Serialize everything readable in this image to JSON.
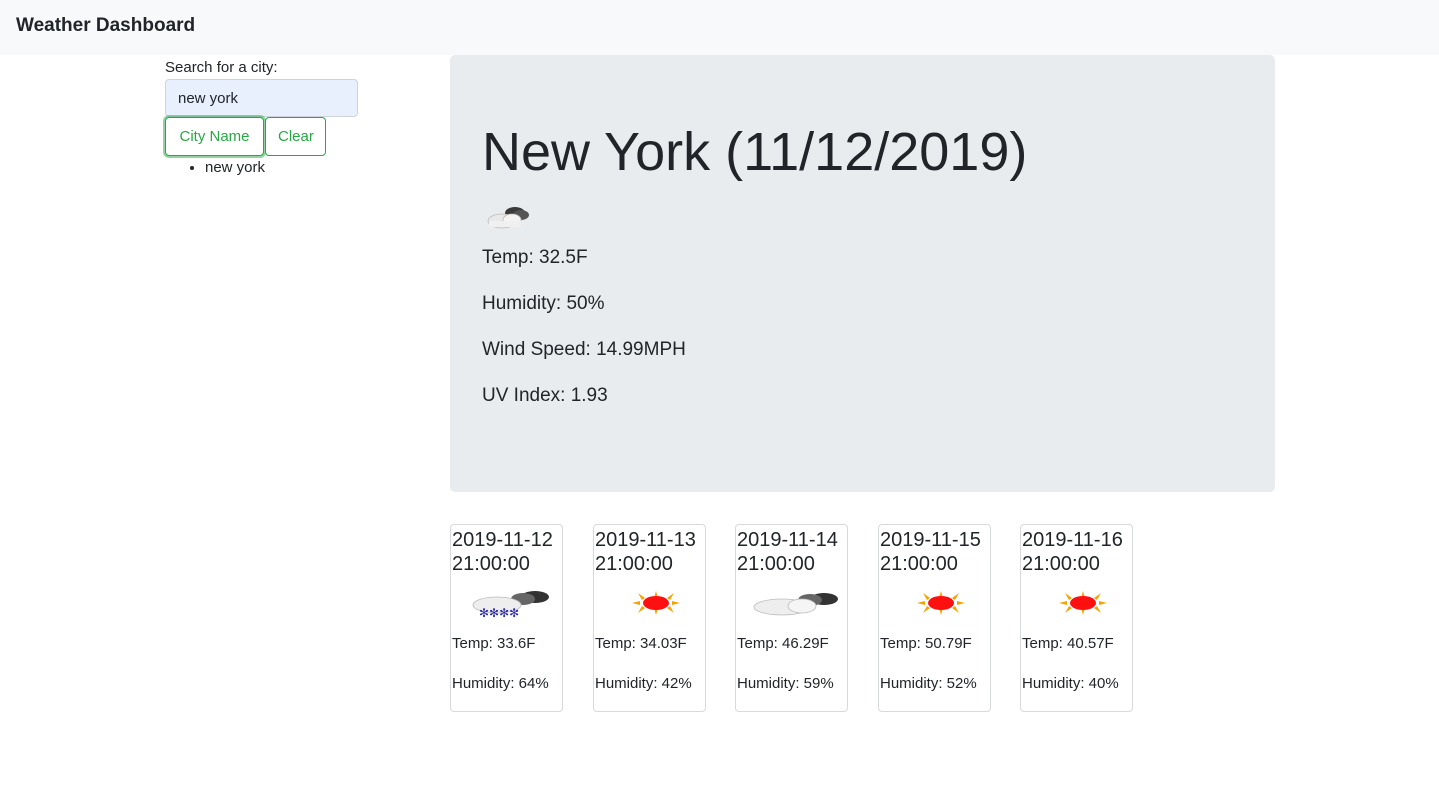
{
  "navbar": {
    "brand": "Weather Dashboard"
  },
  "search": {
    "label": "Search for a city:",
    "value": "new york",
    "city_button": "City Name",
    "clear_button": "Clear",
    "history": [
      "new york"
    ]
  },
  "current": {
    "title": "New York (11/12/2019)",
    "icon": "cloud-icon",
    "temp": "Temp: 32.5F",
    "humidity": "Humidity: 50%",
    "wind": "Wind Speed: 14.99MPH",
    "uv": "UV Index: 1.93"
  },
  "forecast": [
    {
      "date": "2019-11-12 21:00:00",
      "icon": "snow-icon",
      "temp": "Temp: 33.6F",
      "humidity": "Humidity: 64%"
    },
    {
      "date": "2019-11-13 21:00:00",
      "icon": "sun-icon",
      "temp": "Temp: 34.03F",
      "humidity": "Humidity: 42%"
    },
    {
      "date": "2019-11-14 21:00:00",
      "icon": "cloud-icon",
      "temp": "Temp: 46.29F",
      "humidity": "Humidity: 59%"
    },
    {
      "date": "2019-11-15 21:00:00",
      "icon": "sun-icon",
      "temp": "Temp: 50.79F",
      "humidity": "Humidity: 52%"
    },
    {
      "date": "2019-11-16 21:00:00",
      "icon": "sun-icon",
      "temp": "Temp: 40.57F",
      "humidity": "Humidity: 40%"
    }
  ],
  "colors": {
    "accent": "#28a745",
    "navbar_bg": "#f8f9fa",
    "jumbotron_bg": "#e9ecef",
    "input_bg": "#e8f0fe"
  }
}
